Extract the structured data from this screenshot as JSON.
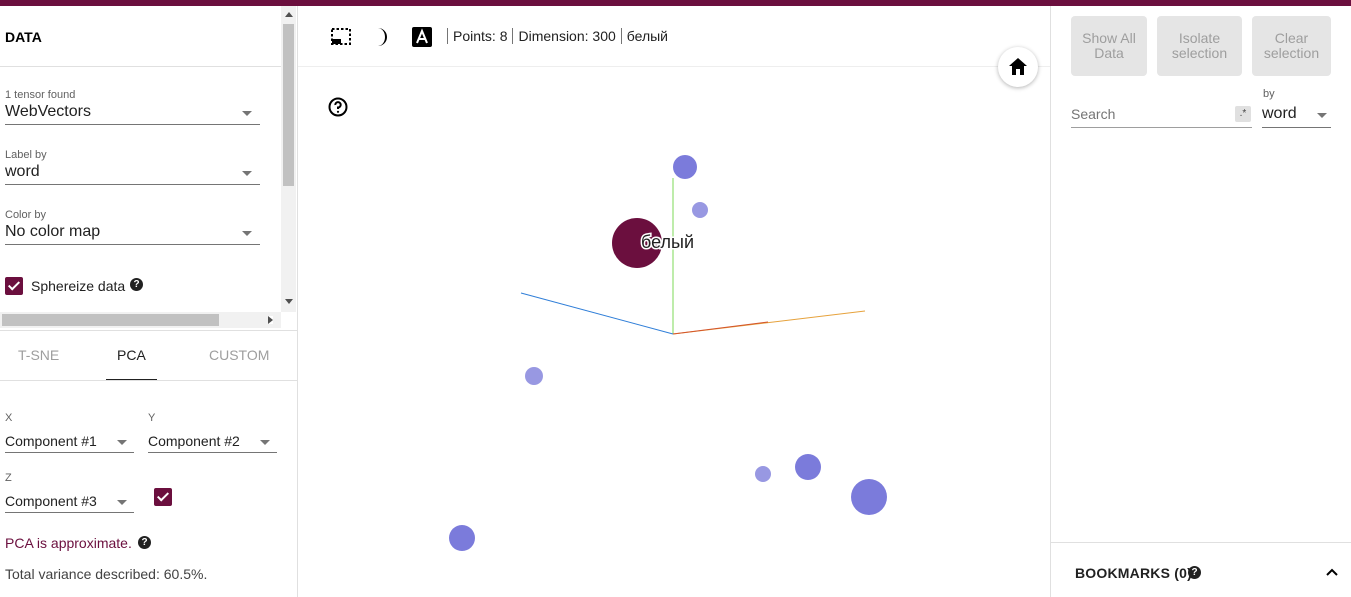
{
  "left_panel": {
    "section_title": "DATA",
    "tensor": {
      "label": "1 tensor found",
      "value": "WebVectors"
    },
    "label_by": {
      "label": "Label by",
      "value": "word"
    },
    "color_by": {
      "label": "Color by",
      "value": "No color map"
    },
    "sphereize": {
      "label": "Sphereize data",
      "checked": true
    },
    "tabs": [
      {
        "label": "T-SNE",
        "active": false
      },
      {
        "label": "PCA",
        "active": true
      },
      {
        "label": "CUSTOM",
        "active": false
      }
    ],
    "pca": {
      "x": {
        "label": "X",
        "value": "Component #1"
      },
      "y": {
        "label": "Y",
        "value": "Component #2"
      },
      "z": {
        "label": "Z",
        "value": "Component #3",
        "enabled": true
      },
      "note": "PCA is approximate.",
      "variance": "Total variance described: 60.5%."
    }
  },
  "toolbar": {
    "icons": [
      "selection-box-icon",
      "night-mode-icon",
      "label-toggle-icon"
    ],
    "points": "Points: 8",
    "dimension": "Dimension: 300",
    "selected_word": "белый"
  },
  "scene": {
    "selected_label": "белый",
    "colors": {
      "selected": "#6b0f3e",
      "point": "#7b7bdb",
      "axis_x": "#e6a23c",
      "axis_y": "#7ed957",
      "axis_z": "#2f7ed8"
    }
  },
  "right_panel": {
    "buttons": {
      "show_all": "Show All Data",
      "isolate": "Isolate selection",
      "clear": "Clear selection"
    },
    "search": {
      "placeholder": "Search",
      "regex": ".*"
    },
    "by": {
      "label": "by",
      "value": "word"
    },
    "bookmarks": {
      "title": "BOOKMARKS (0)"
    }
  }
}
